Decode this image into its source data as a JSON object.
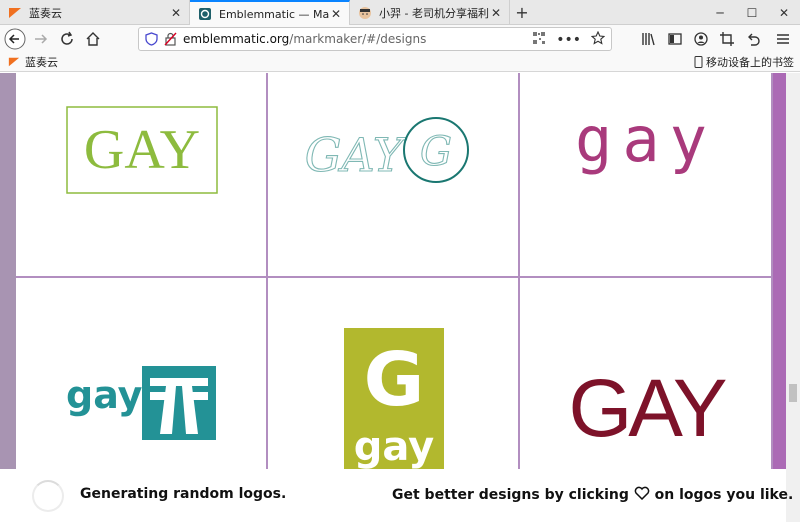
{
  "browser": {
    "tabs": [
      {
        "title": "蓝奏云",
        "active": false
      },
      {
        "title": "Emblemmatic — MarkMaker",
        "active": true
      },
      {
        "title": "小羿 - 老司机分享福利资源，",
        "active": false
      }
    ],
    "url_host": "emblemmatic.org",
    "url_path": "/markmaker/#/designs",
    "bookmarks": [
      {
        "label": "蓝奏云"
      }
    ],
    "mobile_bookmarks": "移动设备上的书签",
    "accent": "#0a84ff"
  },
  "logos": [
    {
      "text": "GAY",
      "color": "#8dbb3e",
      "style": "framed-serif"
    },
    {
      "text": "GAY",
      "monogram": "G",
      "color": "#7fb8b4",
      "ring_color": "#1a7771",
      "style": "script-outline"
    },
    {
      "text": "gay",
      "color": "#a93a7c",
      "style": "mono-spaced"
    },
    {
      "text": "gay",
      "icon_color": "#239296",
      "style": "text-plus-icon"
    },
    {
      "letter": "G",
      "text": "gay",
      "color": "#b2b82e",
      "style": "stacked-badge"
    },
    {
      "text": "GAY",
      "color": "#7d1229",
      "style": "condensed"
    }
  ],
  "footer": {
    "left_text": "Generating random logos.",
    "right_text_before": "Get better designs by clicking",
    "right_text_after": "on logos you like."
  },
  "colors": {
    "sidebar_left": "#a894b2",
    "sidebar_right": "#ab6ab5",
    "grid_line": "#b28ec0"
  }
}
